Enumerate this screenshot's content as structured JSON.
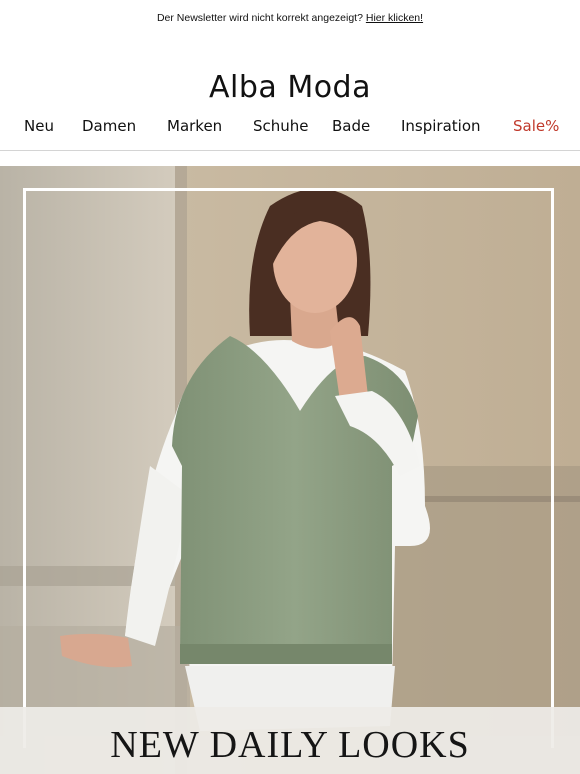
{
  "preheader": {
    "text": "Der Newsletter wird nicht korrekt angezeigt?",
    "link_label": "Hier klicken!"
  },
  "brand": {
    "logo_text": "Alba Moda"
  },
  "nav": {
    "items": [
      {
        "label": "Neu"
      },
      {
        "label": "Damen"
      },
      {
        "label": "Marken"
      },
      {
        "label": "Schuhe"
      },
      {
        "label": "Bade"
      },
      {
        "label": "Inspiration"
      },
      {
        "label": "Sale%"
      }
    ],
    "sale_color": "#c0392b"
  },
  "hero": {
    "caption": "NEW DAILY LOOKS",
    "image_icon": "model-photo",
    "colors": {
      "background_stone": "#cfc4b3",
      "vest_green": "#8b9c80",
      "shirt_white": "#f7f7f5"
    }
  }
}
